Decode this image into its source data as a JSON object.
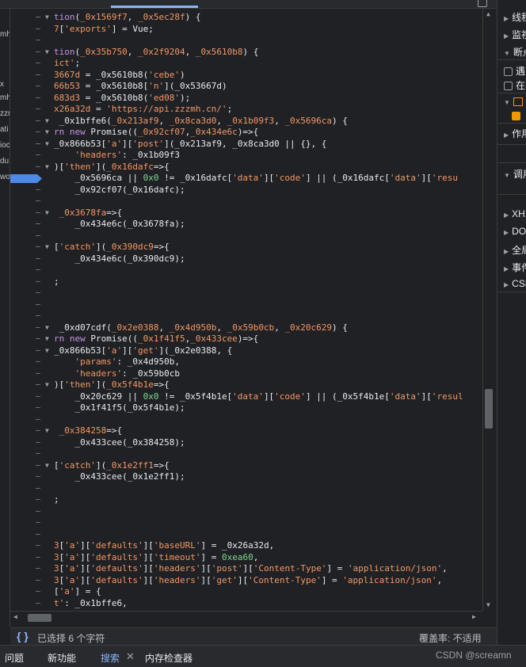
{
  "left_panel": [
    "mh",
    "x",
    "mh",
    "zzr",
    "ati",
    "ioc",
    "du",
    "wo"
  ],
  "code_lines": [
    {
      "arrow": true,
      "segments": [
        {
          "t": "k",
          "v": "tion"
        },
        {
          "t": "p",
          "v": "("
        },
        {
          "t": "s",
          "v": "_0x1569f7"
        },
        {
          "t": "p",
          "v": ", "
        },
        {
          "t": "s",
          "v": "_0x5ec28f"
        },
        {
          "t": "p",
          "v": ") {"
        }
      ]
    },
    {
      "arrow": false,
      "segments": [
        {
          "t": "s",
          "v": "7"
        },
        {
          "t": "p",
          "v": "["
        },
        {
          "t": "s",
          "v": "'exports'"
        },
        {
          "t": "p",
          "v": "] = Vue;"
        }
      ]
    },
    {
      "arrow": false,
      "segments": []
    },
    {
      "arrow": true,
      "segments": [
        {
          "t": "k",
          "v": "tion"
        },
        {
          "t": "p",
          "v": "("
        },
        {
          "t": "s",
          "v": "_0x35b750"
        },
        {
          "t": "p",
          "v": ", "
        },
        {
          "t": "s",
          "v": "_0x2f9204"
        },
        {
          "t": "p",
          "v": ", "
        },
        {
          "t": "s",
          "v": "_0x5610b8"
        },
        {
          "t": "p",
          "v": ") {"
        }
      ]
    },
    {
      "arrow": false,
      "segments": [
        {
          "t": "s",
          "v": "ict'"
        },
        {
          "t": "p",
          "v": ";"
        }
      ]
    },
    {
      "arrow": false,
      "segments": [
        {
          "t": "s",
          "v": "3667d"
        },
        {
          "t": "p",
          "v": " = _0x5610b8("
        },
        {
          "t": "s",
          "v": "'cebe'"
        },
        {
          "t": "p",
          "v": ")"
        }
      ]
    },
    {
      "arrow": false,
      "segments": [
        {
          "t": "s",
          "v": "66b53"
        },
        {
          "t": "p",
          "v": " = _0x5610b8["
        },
        {
          "t": "s",
          "v": "'n'"
        },
        {
          "t": "p",
          "v": "](_0x53667d)"
        }
      ]
    },
    {
      "arrow": false,
      "segments": [
        {
          "t": "s",
          "v": "683d3"
        },
        {
          "t": "p",
          "v": " = _0x5610b8("
        },
        {
          "t": "s",
          "v": "'ed08'"
        },
        {
          "t": "p",
          "v": ");"
        }
      ]
    },
    {
      "arrow": false,
      "segments": [
        {
          "t": "s",
          "v": "x26a32d"
        },
        {
          "t": "p",
          "v": " = "
        },
        {
          "t": "s",
          "v": "'https://api.zzzmh.cn/'"
        },
        {
          "t": "p",
          "v": ";"
        }
      ]
    },
    {
      "arrow": true,
      "segments": [
        {
          "t": "p",
          "v": " _0x1bffe6("
        },
        {
          "t": "s",
          "v": "_0x213af9"
        },
        {
          "t": "p",
          "v": ", "
        },
        {
          "t": "s",
          "v": "_0x8ca3d0"
        },
        {
          "t": "p",
          "v": ", "
        },
        {
          "t": "s",
          "v": "_0x1b09f3"
        },
        {
          "t": "p",
          "v": ", "
        },
        {
          "t": "s",
          "v": "_0x5696ca"
        },
        {
          "t": "p",
          "v": ") {"
        }
      ]
    },
    {
      "arrow": true,
      "segments": [
        {
          "t": "k",
          "v": "rn new "
        },
        {
          "t": "p",
          "v": "Promise(("
        },
        {
          "t": "s",
          "v": "_0x92cf07"
        },
        {
          "t": "p",
          "v": ","
        },
        {
          "t": "s",
          "v": "_0x434e6c"
        },
        {
          "t": "p",
          "v": ")=>{"
        }
      ]
    },
    {
      "arrow": true,
      "segments": [
        {
          "t": "p",
          "v": "_0x866b53["
        },
        {
          "t": "s",
          "v": "'a'"
        },
        {
          "t": "p",
          "v": "]["
        },
        {
          "t": "s",
          "v": "'post'"
        },
        {
          "t": "p",
          "v": "](_0x213af9, _0x8ca3d0 || {}, {"
        }
      ]
    },
    {
      "arrow": false,
      "segments": [
        {
          "t": "p",
          "v": "    "
        },
        {
          "t": "s",
          "v": "'headers'"
        },
        {
          "t": "p",
          "v": ": _0x1b09f3"
        }
      ]
    },
    {
      "arrow": true,
      "segments": [
        {
          "t": "p",
          "v": ")["
        },
        {
          "t": "s",
          "v": "'then'"
        },
        {
          "t": "p",
          "v": "]("
        },
        {
          "t": "s",
          "v": "_0x16dafc"
        },
        {
          "t": "p",
          "v": "=>{"
        }
      ]
    },
    {
      "arrow": false,
      "breakpoint": true,
      "segments": [
        {
          "t": "p",
          "v": "    "
        },
        {
          "t": "p",
          "v": "_0x5696ca || "
        },
        {
          "t": "n",
          "v": "0x0"
        },
        {
          "t": "p",
          "v": " != _0x16dafc["
        },
        {
          "t": "s",
          "v": "'data'"
        },
        {
          "t": "p",
          "v": "]["
        },
        {
          "t": "s",
          "v": "'code'"
        },
        {
          "t": "p",
          "v": "] || (_0x16dafc["
        },
        {
          "t": "s",
          "v": "'data'"
        },
        {
          "t": "p",
          "v": "]["
        },
        {
          "t": "s",
          "v": "'resu"
        }
      ]
    },
    {
      "arrow": false,
      "segments": [
        {
          "t": "p",
          "v": "    _0x92cf07(_0x16dafc);"
        }
      ]
    },
    {
      "arrow": false,
      "segments": [
        {
          "t": "p",
          "v": ""
        }
      ]
    },
    {
      "arrow": true,
      "segments": [
        {
          "t": "p",
          "v": " "
        },
        {
          "t": "s",
          "v": "_0x3678fa"
        },
        {
          "t": "p",
          "v": "=>{"
        }
      ]
    },
    {
      "arrow": false,
      "segments": [
        {
          "t": "p",
          "v": "    _0x434e6c(_0x3678fa);"
        }
      ]
    },
    {
      "arrow": false,
      "segments": [
        {
          "t": "p",
          "v": ""
        }
      ]
    },
    {
      "arrow": true,
      "segments": [
        {
          "t": "p",
          "v": "["
        },
        {
          "t": "s",
          "v": "'catch'"
        },
        {
          "t": "p",
          "v": "]("
        },
        {
          "t": "s",
          "v": "_0x390dc9"
        },
        {
          "t": "p",
          "v": "=>{"
        }
      ]
    },
    {
      "arrow": false,
      "segments": [
        {
          "t": "p",
          "v": "    _0x434e6c(_0x390dc9);"
        }
      ]
    },
    {
      "arrow": false,
      "segments": [
        {
          "t": "p",
          "v": ""
        }
      ]
    },
    {
      "arrow": false,
      "segments": [
        {
          "t": "p",
          "v": ";"
        }
      ]
    },
    {
      "arrow": false,
      "segments": []
    },
    {
      "arrow": false,
      "segments": []
    },
    {
      "arrow": false,
      "segments": []
    },
    {
      "arrow": true,
      "segments": [
        {
          "t": "p",
          "v": " _0xd07cdf("
        },
        {
          "t": "s",
          "v": "_0x2e0388"
        },
        {
          "t": "p",
          "v": ", "
        },
        {
          "t": "s",
          "v": "_0x4d950b"
        },
        {
          "t": "p",
          "v": ", "
        },
        {
          "t": "s",
          "v": "_0x59b0cb"
        },
        {
          "t": "p",
          "v": ", "
        },
        {
          "t": "s",
          "v": "_0x20c629"
        },
        {
          "t": "p",
          "v": ") {"
        }
      ]
    },
    {
      "arrow": true,
      "segments": [
        {
          "t": "k",
          "v": "rn new "
        },
        {
          "t": "p",
          "v": "Promise(("
        },
        {
          "t": "s",
          "v": "_0x1f41f5"
        },
        {
          "t": "p",
          "v": ","
        },
        {
          "t": "s",
          "v": "_0x433cee"
        },
        {
          "t": "p",
          "v": ")=>{"
        }
      ]
    },
    {
      "arrow": true,
      "segments": [
        {
          "t": "p",
          "v": "_0x866b53["
        },
        {
          "t": "s",
          "v": "'a'"
        },
        {
          "t": "p",
          "v": "]["
        },
        {
          "t": "s",
          "v": "'get'"
        },
        {
          "t": "p",
          "v": "](_0x2e0388, {"
        }
      ]
    },
    {
      "arrow": false,
      "segments": [
        {
          "t": "p",
          "v": "    "
        },
        {
          "t": "s",
          "v": "'params'"
        },
        {
          "t": "p",
          "v": ": _0x4d950b,"
        }
      ]
    },
    {
      "arrow": false,
      "segments": [
        {
          "t": "p",
          "v": "    "
        },
        {
          "t": "s",
          "v": "'headers'"
        },
        {
          "t": "p",
          "v": ": _0x59b0cb"
        }
      ]
    },
    {
      "arrow": true,
      "segments": [
        {
          "t": "p",
          "v": ")["
        },
        {
          "t": "s",
          "v": "'then'"
        },
        {
          "t": "p",
          "v": "]("
        },
        {
          "t": "s",
          "v": "_0x5f4b1e"
        },
        {
          "t": "p",
          "v": "=>{"
        }
      ]
    },
    {
      "arrow": false,
      "segments": [
        {
          "t": "p",
          "v": "    _0x20c629 || "
        },
        {
          "t": "n",
          "v": "0x0"
        },
        {
          "t": "p",
          "v": " != _0x5f4b1e["
        },
        {
          "t": "s",
          "v": "'data'"
        },
        {
          "t": "p",
          "v": "]["
        },
        {
          "t": "s",
          "v": "'code'"
        },
        {
          "t": "p",
          "v": "] || (_0x5f4b1e["
        },
        {
          "t": "s",
          "v": "'data'"
        },
        {
          "t": "p",
          "v": "]["
        },
        {
          "t": "s",
          "v": "'resul"
        }
      ]
    },
    {
      "arrow": false,
      "segments": [
        {
          "t": "p",
          "v": "    _0x1f41f5(_0x5f4b1e);"
        }
      ]
    },
    {
      "arrow": false,
      "segments": [
        {
          "t": "p",
          "v": ""
        }
      ]
    },
    {
      "arrow": true,
      "segments": [
        {
          "t": "p",
          "v": " "
        },
        {
          "t": "s",
          "v": "_0x384258"
        },
        {
          "t": "p",
          "v": "=>{"
        }
      ]
    },
    {
      "arrow": false,
      "segments": [
        {
          "t": "p",
          "v": "    _0x433cee(_0x384258);"
        }
      ]
    },
    {
      "arrow": false,
      "segments": [
        {
          "t": "p",
          "v": ""
        }
      ]
    },
    {
      "arrow": true,
      "segments": [
        {
          "t": "p",
          "v": "["
        },
        {
          "t": "s",
          "v": "'catch'"
        },
        {
          "t": "p",
          "v": "]("
        },
        {
          "t": "s",
          "v": "_0x1e2ff1"
        },
        {
          "t": "p",
          "v": "=>{"
        }
      ]
    },
    {
      "arrow": false,
      "segments": [
        {
          "t": "p",
          "v": "    _0x433cee(_0x1e2ff1);"
        }
      ]
    },
    {
      "arrow": false,
      "segments": [
        {
          "t": "p",
          "v": ""
        }
      ]
    },
    {
      "arrow": false,
      "segments": [
        {
          "t": "p",
          "v": ";"
        }
      ]
    },
    {
      "arrow": false,
      "segments": []
    },
    {
      "arrow": false,
      "segments": []
    },
    {
      "arrow": false,
      "segments": []
    },
    {
      "arrow": false,
      "segments": [
        {
          "t": "s",
          "v": "3"
        },
        {
          "t": "p",
          "v": "["
        },
        {
          "t": "s",
          "v": "'a'"
        },
        {
          "t": "p",
          "v": "]["
        },
        {
          "t": "s",
          "v": "'defaults'"
        },
        {
          "t": "p",
          "v": "]["
        },
        {
          "t": "s",
          "v": "'baseURL'"
        },
        {
          "t": "p",
          "v": "] = _0x26a32d,"
        }
      ]
    },
    {
      "arrow": false,
      "segments": [
        {
          "t": "s",
          "v": "3"
        },
        {
          "t": "p",
          "v": "["
        },
        {
          "t": "s",
          "v": "'a'"
        },
        {
          "t": "p",
          "v": "]["
        },
        {
          "t": "s",
          "v": "'defaults'"
        },
        {
          "t": "p",
          "v": "]["
        },
        {
          "t": "s",
          "v": "'timeout'"
        },
        {
          "t": "p",
          "v": "] = "
        },
        {
          "t": "n",
          "v": "0xea60"
        },
        {
          "t": "p",
          "v": ","
        }
      ]
    },
    {
      "arrow": false,
      "segments": [
        {
          "t": "s",
          "v": "3"
        },
        {
          "t": "p",
          "v": "["
        },
        {
          "t": "s",
          "v": "'a'"
        },
        {
          "t": "p",
          "v": "]["
        },
        {
          "t": "s",
          "v": "'defaults'"
        },
        {
          "t": "p",
          "v": "]["
        },
        {
          "t": "s",
          "v": "'headers'"
        },
        {
          "t": "p",
          "v": "]["
        },
        {
          "t": "s",
          "v": "'post'"
        },
        {
          "t": "p",
          "v": "]["
        },
        {
          "t": "s",
          "v": "'Content-Type'"
        },
        {
          "t": "p",
          "v": "] = "
        },
        {
          "t": "s",
          "v": "'application/json'"
        },
        {
          "t": "p",
          "v": ","
        }
      ]
    },
    {
      "arrow": false,
      "segments": [
        {
          "t": "s",
          "v": "3"
        },
        {
          "t": "p",
          "v": "["
        },
        {
          "t": "s",
          "v": "'a'"
        },
        {
          "t": "p",
          "v": "]["
        },
        {
          "t": "s",
          "v": "'defaults'"
        },
        {
          "t": "p",
          "v": "]["
        },
        {
          "t": "s",
          "v": "'headers'"
        },
        {
          "t": "p",
          "v": "]["
        },
        {
          "t": "s",
          "v": "'get'"
        },
        {
          "t": "p",
          "v": "]["
        },
        {
          "t": "s",
          "v": "'Content-Type'"
        },
        {
          "t": "p",
          "v": "] = "
        },
        {
          "t": "s",
          "v": "'application/json'"
        },
        {
          "t": "p",
          "v": ","
        }
      ]
    },
    {
      "arrow": false,
      "segments": [
        {
          "t": "p",
          "v": "["
        },
        {
          "t": "s",
          "v": "'a'"
        },
        {
          "t": "p",
          "v": "] = {"
        }
      ]
    },
    {
      "arrow": false,
      "segments": [
        {
          "t": "s",
          "v": "t'"
        },
        {
          "t": "p",
          "v": ": _0x1bffe6,"
        }
      ]
    }
  ],
  "status": {
    "braces": "{ }",
    "selection": "已选择 6 个字符",
    "coverage": "覆盖率: 不适用"
  },
  "right_panel": {
    "items": [
      {
        "label": "线程",
        "kind": "section"
      },
      {
        "label": "监视",
        "kind": "section"
      },
      {
        "label": "断点",
        "kind": "section-open"
      },
      {
        "label": "遇到",
        "kind": "checkbox"
      },
      {
        "label": "在异",
        "kind": "checkbox"
      },
      {
        "label": "",
        "kind": "js-file"
      },
      {
        "label": "",
        "kind": "checked"
      },
      {
        "label": "作用",
        "kind": "section"
      },
      {
        "label": "调用",
        "kind": "section-open"
      },
      {
        "label": "XH",
        "kind": "section"
      },
      {
        "label": "DO",
        "kind": "section"
      },
      {
        "label": "全局",
        "kind": "section"
      },
      {
        "label": "事件",
        "kind": "section"
      },
      {
        "label": "CSP",
        "kind": "section"
      }
    ]
  },
  "drawer": {
    "tabs": [
      "问题",
      "新功能",
      "搜索",
      "内存检查器"
    ],
    "active": "搜索",
    "close": "✕"
  },
  "watermark": "CSDN @screamn",
  "colors": {
    "breakpoint": "#4d8ae5",
    "accent": "#8ab4f8",
    "string": "#f29766",
    "keyword": "#c792ea",
    "number": "#7fd88f"
  }
}
